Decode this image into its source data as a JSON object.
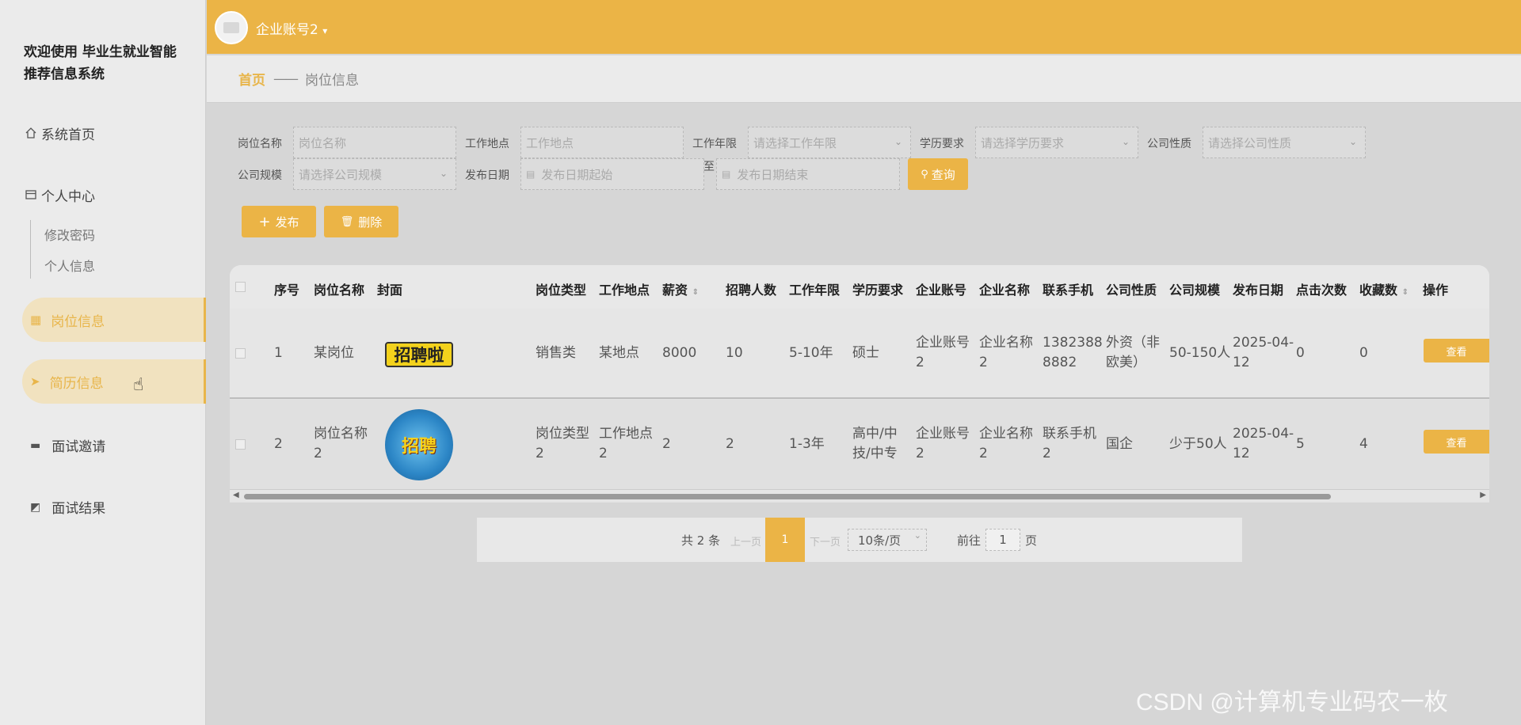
{
  "sidebar": {
    "system_title": "欢迎使用 毕业生就业智能推荐信息系统",
    "home": "系统首页",
    "personal_center": "个人中心",
    "change_password": "修改密码",
    "personal_info": "个人信息",
    "job_info": "岗位信息",
    "resume_info": "简历信息",
    "interview_invite": "面试邀请",
    "interview_result": "面试结果"
  },
  "topbar": {
    "account_name": "企业账号2",
    "dropdown_glyph": "▾"
  },
  "breadcrumb": {
    "home": "首页",
    "separator": "——",
    "current": "岗位信息"
  },
  "filters": {
    "job_name": {
      "label": "岗位名称",
      "placeholder": "岗位名称"
    },
    "work_location": {
      "label": "工作地点",
      "placeholder": "工作地点"
    },
    "work_years": {
      "label": "工作年限",
      "placeholder": "请选择工作年限"
    },
    "education": {
      "label": "学历要求",
      "placeholder": "请选择学历要求"
    },
    "company_nature": {
      "label": "公司性质",
      "placeholder": "请选择公司性质"
    },
    "company_scale": {
      "label": "公司规模",
      "placeholder": "请选择公司规模"
    },
    "publish_date": {
      "label": "发布日期",
      "start_placeholder": "发布日期起始",
      "to": "至",
      "end_placeholder": "发布日期结束"
    },
    "search_button": "查询"
  },
  "actions": {
    "publish": "发布",
    "delete": "删除"
  },
  "table": {
    "headers": [
      "序号",
      "岗位名称",
      "封面",
      "岗位类型",
      "工作地点",
      "薪资",
      "招聘人数",
      "工作年限",
      "学历要求",
      "企业账号",
      "企业名称",
      "联系手机",
      "公司性质",
      "公司规模",
      "发布日期",
      "点击次数",
      "收藏数",
      "操作"
    ],
    "rows": [
      {
        "index": "1",
        "job_name": [
          "某岗位"
        ],
        "cover_text": "招聘啦",
        "job_type": [
          "销售类"
        ],
        "location": [
          "某地点"
        ],
        "salary": "8000",
        "headcount": "10",
        "years": "5-10年",
        "education": [
          "硕士"
        ],
        "account": [
          "企业账号",
          "2"
        ],
        "company": [
          "企业名称",
          "2"
        ],
        "phone": [
          "1382388",
          "8882"
        ],
        "nature": [
          "外资（非",
          "欧美）"
        ],
        "scale": "50-150人",
        "date": [
          "2025-04-",
          "12"
        ],
        "clicks": "0",
        "favorites": "0",
        "action": "查看"
      },
      {
        "index": "2",
        "job_name": [
          "岗位名称",
          "2"
        ],
        "cover_text": "招聘",
        "job_type": [
          "岗位类型",
          "2"
        ],
        "location": [
          "工作地点",
          "2"
        ],
        "salary": "2",
        "headcount": "2",
        "years": "1-3年",
        "education": [
          "高中/中",
          "技/中专"
        ],
        "account": [
          "企业账号",
          "2"
        ],
        "company": [
          "企业名称",
          "2"
        ],
        "phone": [
          "联系手机",
          "2"
        ],
        "nature": [
          "国企"
        ],
        "scale": "少于50人",
        "date": [
          "2025-04-",
          "12"
        ],
        "clicks": "5",
        "favorites": "4",
        "action": "查看"
      }
    ]
  },
  "pagination": {
    "total": "共 2 条",
    "prev": "上一页",
    "current_page": "1",
    "next": "下一页",
    "page_size": "10条/页",
    "goto_label": "前往",
    "goto_value": "1",
    "page_suffix": "页"
  },
  "watermark": "CSDN @计算机专业码农一枚",
  "colors": {
    "accent": "#ebb446",
    "sidebar_bg": "#ebebeb",
    "content_bg": "#d6d6d6"
  }
}
